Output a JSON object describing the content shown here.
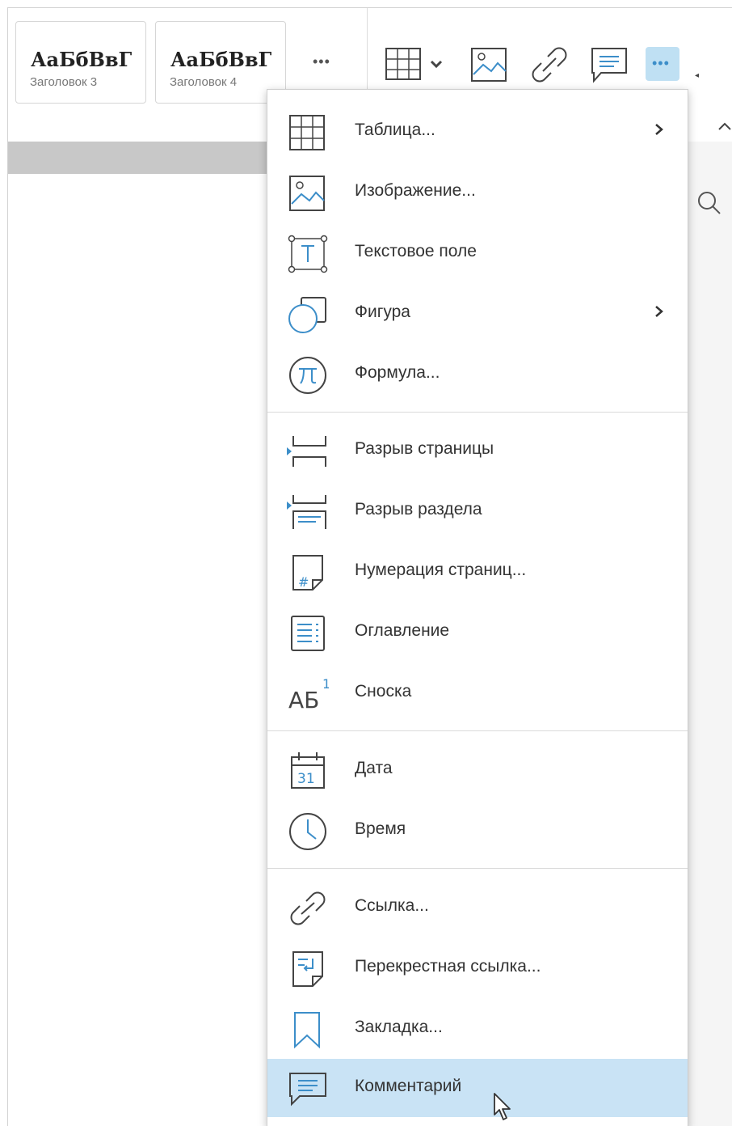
{
  "toolbar": {
    "styles": [
      {
        "sample": "АаБбВвГ",
        "name": "Заголовок 3"
      },
      {
        "sample": "АаБбВвГ",
        "name": "Заголовок 4"
      }
    ],
    "styles_more": "•••",
    "more_button": "•••",
    "icons": [
      "table-icon",
      "image-icon",
      "link-icon",
      "comment-icon",
      "more-icon",
      "search-icon"
    ]
  },
  "menu": {
    "groups": [
      [
        {
          "label": "Таблица...",
          "icon": "table-icon",
          "submenu": true
        },
        {
          "label": "Изображение...",
          "icon": "image-icon",
          "submenu": false
        },
        {
          "label": "Текстовое поле",
          "icon": "text-box-icon",
          "submenu": false
        },
        {
          "label": "Фигура",
          "icon": "shape-icon",
          "submenu": true
        },
        {
          "label": "Формула...",
          "icon": "formula-icon",
          "submenu": false
        }
      ],
      [
        {
          "label": "Разрыв страницы",
          "icon": "page-break-icon",
          "submenu": false
        },
        {
          "label": "Разрыв раздела",
          "icon": "section-break-icon",
          "submenu": false
        },
        {
          "label": "Нумерация страниц...",
          "icon": "page-numbering-icon",
          "submenu": false
        },
        {
          "label": "Оглавление",
          "icon": "table-of-contents-icon",
          "submenu": false
        },
        {
          "label": "Сноска",
          "icon": "footnote-icon",
          "submenu": false
        }
      ],
      [
        {
          "label": "Дата",
          "icon": "calendar-icon",
          "submenu": false
        },
        {
          "label": "Время",
          "icon": "clock-icon",
          "submenu": false
        }
      ],
      [
        {
          "label": "Ссылка...",
          "icon": "link-icon",
          "submenu": false
        },
        {
          "label": "Перекрестная ссылка...",
          "icon": "cross-reference-icon",
          "submenu": false
        },
        {
          "label": "Закладка...",
          "icon": "bookmark-icon",
          "submenu": false
        },
        {
          "label": "Комментарий",
          "icon": "comment-icon",
          "submenu": false,
          "highlighted": true
        }
      ]
    ],
    "footnote_glyph": "АБ",
    "footnote_sup": "1",
    "calendar_day": "31",
    "formula_glyph": "π",
    "textbox_glyph": "T",
    "page_num_glyph": "#"
  },
  "colors": {
    "accent": "#3c8ec9",
    "highlight": "#c9e3f5",
    "icon_stroke": "#444444"
  }
}
